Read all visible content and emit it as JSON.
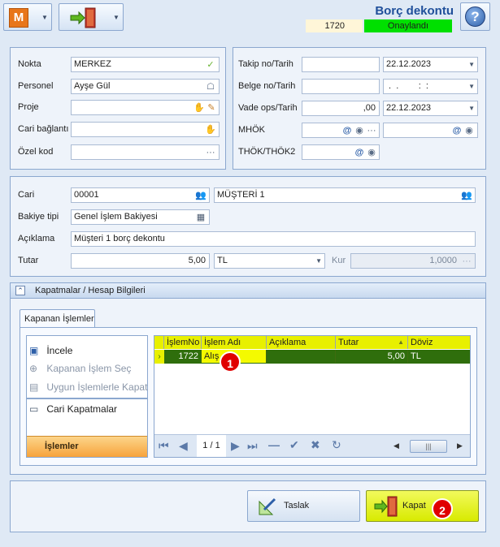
{
  "header": {
    "title": "Borç dekontu",
    "doc_no": "1720",
    "status": "Onaylandı",
    "logo_letter": "M",
    "help_symbol": "?"
  },
  "top_left": {
    "nokta_label": "Nokta",
    "nokta_value": "MERKEZ",
    "personel_label": "Personel",
    "personel_value": "Ayşe Gül",
    "proje_label": "Proje",
    "proje_value": "",
    "cari_baglanti_label": "Cari bağlantı",
    "cari_baglanti_value": "",
    "ozel_kod_label": "Özel kod",
    "ozel_kod_value": "",
    "ellipsis": "···"
  },
  "top_right": {
    "takip_label": "Takip no/Tarih",
    "takip_no": "",
    "takip_date": "22.12.2023",
    "belge_label": "Belge no/Tarih",
    "belge_no": "",
    "belge_date": " .  .        :  :",
    "vade_label": "Vade ops/Tarih",
    "vade_ops": ",00",
    "vade_date": "22.12.2023",
    "mhok_label": "MHÖK",
    "thok_label": "THÖK/THÖK2",
    "at_symbol": "@"
  },
  "cari_section": {
    "cari_label": "Cari",
    "cari_code": "00001",
    "cari_name": "MÜŞTERİ 1",
    "bakiye_label": "Bakiye tipi",
    "bakiye_value": "Genel İşlem Bakiyesi",
    "aciklama_label": "Açıklama",
    "aciklama_value": "Müşteri 1 borç dekontu",
    "tutar_label": "Tutar",
    "tutar_value": "5,00",
    "currency": "TL",
    "kur_label": "Kur",
    "kur_value": "1,0000"
  },
  "kapatmalar": {
    "header_label": "Kapatmalar / Hesap Bilgileri",
    "tab_label": "Kapanan İşlemler",
    "actions": [
      "İncele",
      "Kapanan İşlem Seç",
      "Uygun İşlemlerle Kapat",
      "Cari Kapatmalar"
    ],
    "actions_footer": "İşlemler",
    "grid_columns": [
      "İşlemNo",
      "İşlem Adı",
      "Açıklama",
      "Tutar",
      "Döviz"
    ],
    "grid_row": {
      "islem_no": "1722",
      "islem_adi": "Alış",
      "aciklama": "",
      "tutar": "5,00",
      "doviz": "TL"
    },
    "page_indicator": "1 / 1"
  },
  "footer": {
    "taslak_label": "Taslak",
    "kapat_label": "Kapat"
  },
  "badges": [
    "1",
    "2"
  ],
  "colors": {
    "accent_green": "#00e000",
    "grid_header_yellow": "#e8f000",
    "grid_row_green": "#2f6e0c",
    "kapat_yellow": "#e6f500",
    "badge_red": "#e00000",
    "title_blue": "#1f4f9a"
  }
}
